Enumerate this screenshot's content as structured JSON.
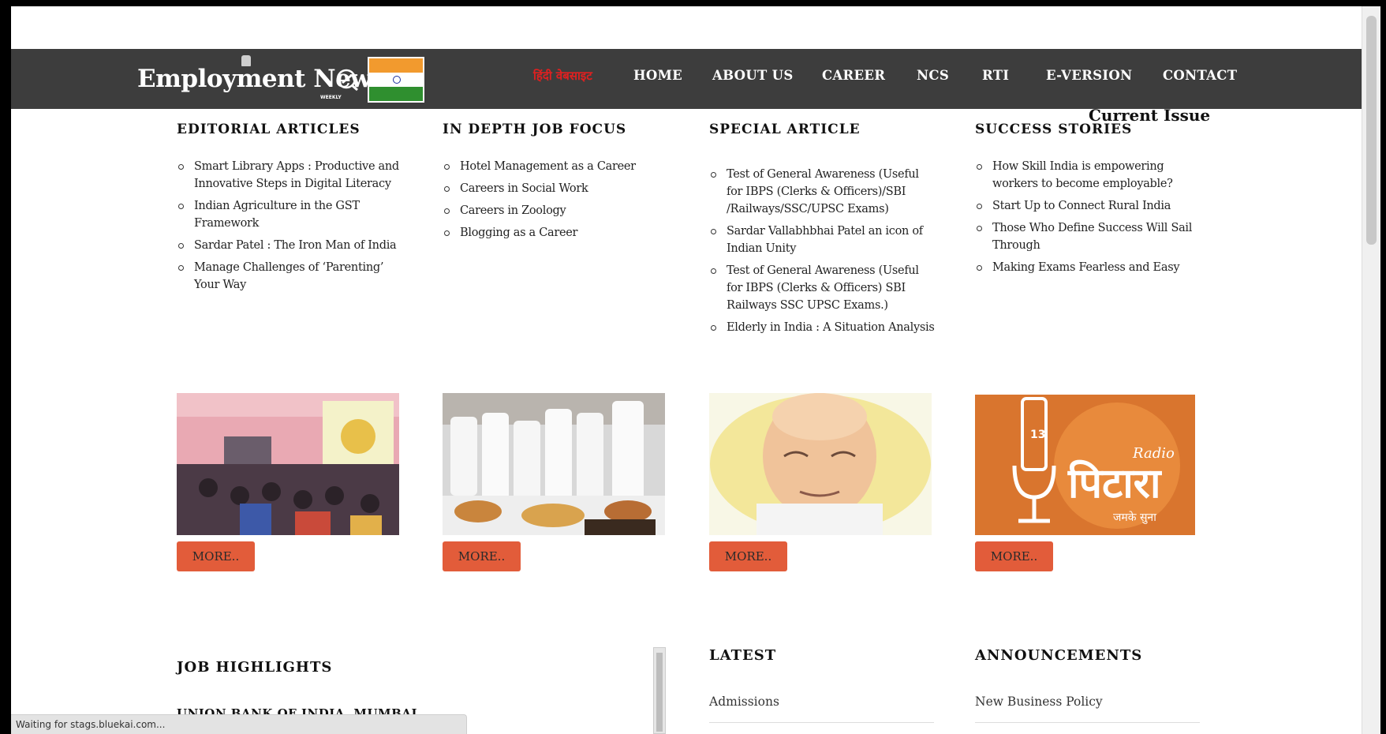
{
  "nav": {
    "hindi_link": "हिंदी वेबसाइट",
    "items": [
      "HOME",
      "ABOUT US",
      "CAREER",
      "NCS",
      "RTI",
      "E-VERSION",
      "CONTACT"
    ]
  },
  "logo": {
    "text": "Employment News",
    "sub": "WEEKLY"
  },
  "current_issue": "Current Issue",
  "columns": [
    {
      "heading": "EDITORIAL ARTICLES",
      "items": [
        "Smart Library Apps : Productive and Innovative Steps in Digital Literacy",
        "Indian Agriculture in the GST Framework",
        "Sardar Patel : The Iron Man of India",
        "Manage Challenges of ‘Parenting’ Your Way"
      ],
      "more": "MORE.."
    },
    {
      "heading": "IN DEPTH JOB FOCUS",
      "items": [
        "Hotel Management as a Career",
        "Careers in Social Work",
        "Careers in Zoology",
        "Blogging as a Career"
      ],
      "more": "MORE.."
    },
    {
      "heading": "SPECIAL ARTICLE",
      "items": [
        "Test of General Awareness (Useful for IBPS (Clerks & Officers)/SBI /Railways/SSC/UPSC Exams)",
        "Sardar Vallabhbhai Patel an icon of Indian Unity",
        "Test of General Awareness (Useful for IBPS (Clerks & Officers) SBI Railways SSC UPSC Exams.)",
        "Elderly in India : A Situation Analysis"
      ],
      "more": "MORE.."
    },
    {
      "heading": "SUCCESS STORIES",
      "items": [
        "How Skill India is empowering workers to become employable?",
        "Start Up to Connect Rural India",
        "Those Who Define Success Will Sail Through",
        "Making Exams Fearless and Easy"
      ],
      "more": "MORE.."
    }
  ],
  "radio_image": {
    "brand": "Radio",
    "hindi": "पिटारा",
    "tag": "जमके सुना",
    "badge": "13"
  },
  "job_highlights": {
    "title": "JOB HIGHLIGHTS",
    "first_item": "UNION BANK OF INDIA, MUMBAI"
  },
  "latest": {
    "title": "LATEST",
    "first_item": "Admissions"
  },
  "announcements": {
    "title": "ANNOUNCEMENTS",
    "first_item": "New Business Policy"
  },
  "status_bar": "Waiting for stags.bluekai.com...",
  "colors": {
    "navbar": "#3d3d3d",
    "more_button": "#e25c3a",
    "hindi_link": "#e02020"
  }
}
